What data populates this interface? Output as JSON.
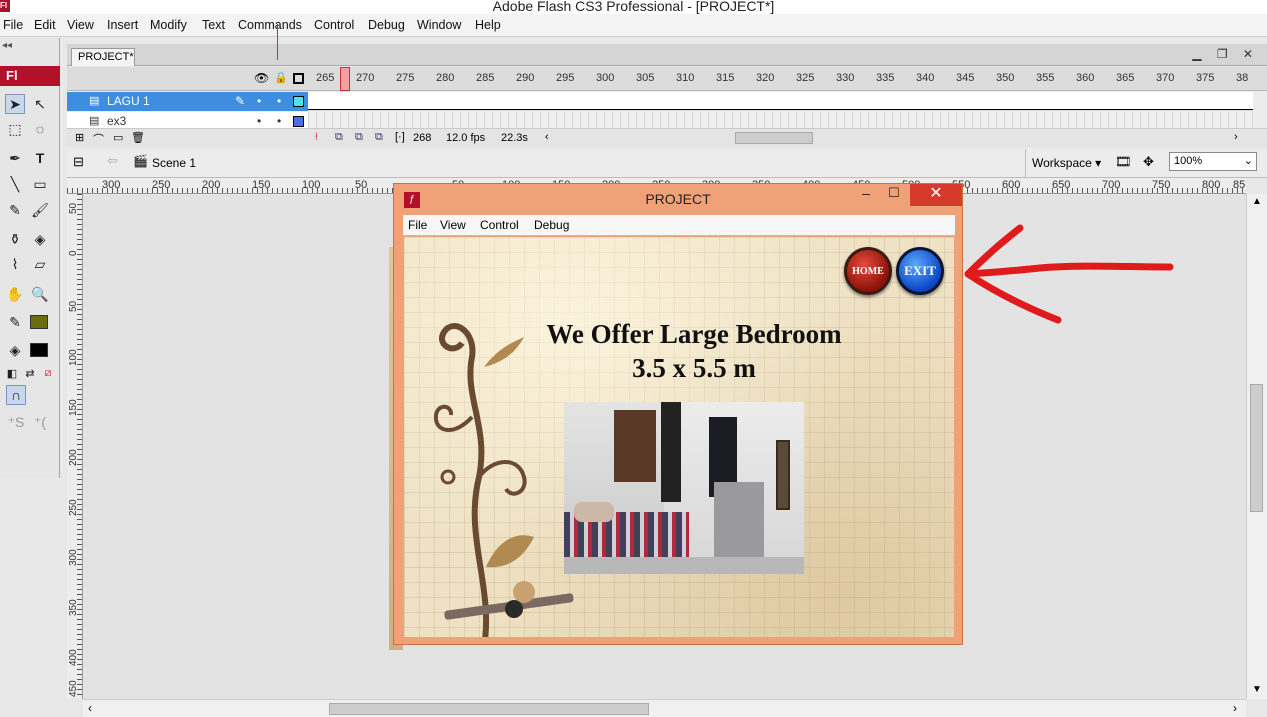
{
  "titlebar": {
    "title": "Adobe Flash CS3 Professional - [PROJECT*]",
    "logo": "Fl"
  },
  "menubar": {
    "items": [
      "File",
      "Edit",
      "View",
      "Insert",
      "Modify",
      "Text",
      "Commands",
      "Control",
      "Debug",
      "Window",
      "Help"
    ]
  },
  "toolspanel": {
    "logo": "Fl"
  },
  "document": {
    "tab": "PROJECT*"
  },
  "timeline": {
    "frame_numbers": [
      "265",
      "270",
      "275",
      "280",
      "285",
      "290",
      "295",
      "300",
      "305",
      "310",
      "315",
      "320",
      "325",
      "330",
      "335",
      "340",
      "345",
      "350",
      "355",
      "360",
      "365",
      "370",
      "375",
      "38"
    ],
    "layers": [
      {
        "name": "LAGU 1",
        "selected": true
      },
      {
        "name": "ex3",
        "selected": false
      }
    ],
    "status": {
      "frame": "268",
      "fps": "12.0 fps",
      "time": "22.3s"
    }
  },
  "scenebar": {
    "scene": "Scene 1",
    "workspace": "Workspace",
    "zoom": "100%"
  },
  "ruler": {
    "horizontal": [
      "300",
      "250",
      "200",
      "150",
      "100",
      "50",
      "",
      "50",
      "100",
      "150",
      "200",
      "250",
      "300",
      "350",
      "400",
      "450",
      "500",
      "550",
      "600",
      "650",
      "700",
      "750",
      "800",
      "85"
    ],
    "vertical": [
      "50",
      "0",
      "50",
      "100",
      "150",
      "200",
      "250",
      "300",
      "350",
      "400",
      "450"
    ]
  },
  "player": {
    "title": "PROJECT",
    "menu": [
      "File",
      "View",
      "Control",
      "Debug"
    ],
    "headline_line1": "We Offer Large Bedroom",
    "headline_line2": "3.5 x 5.5 m",
    "home_label": "HOME",
    "exit_label": "EXIT"
  },
  "colors": {
    "accent_layer": "#3d8ee0",
    "flash_red": "#b3112a",
    "arrow": "#e01b1b",
    "player_frame": "#f0a178"
  }
}
